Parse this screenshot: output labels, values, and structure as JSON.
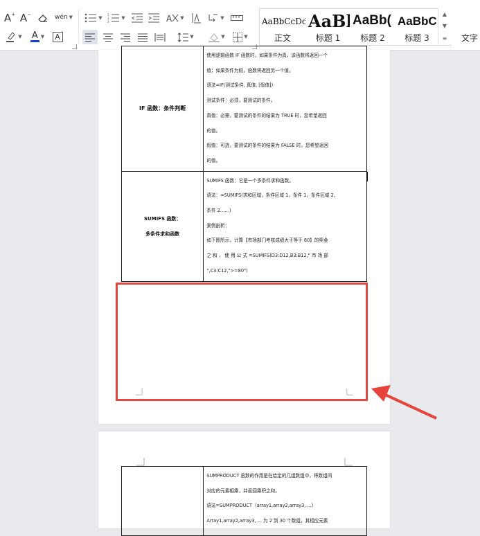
{
  "ribbon": {
    "font": {
      "grow_label": "A",
      "shrink_label": "A",
      "phonetic_label": "wén"
    },
    "styles": [
      {
        "sample": "AaBbCcDd",
        "label": "正文"
      },
      {
        "sample": "AaBl",
        "label": "标题 1"
      },
      {
        "sample": "AaBb(",
        "label": "标题 2"
      },
      {
        "sample": "AaBbC",
        "label": "标题 3"
      }
    ],
    "text_tool_label": "文字"
  },
  "page1": {
    "table": [
      {
        "label": "IF 函数：条件判断",
        "lines": [
          "使用逻辑函数 IF 函数时，如果条件为真，该函数将返回一个",
          "值；如果条件为假，函数将返回另一个值。",
          "语法=IF(测试条件, 真值, [假值])",
          "测试条件：必须，要测试的条件。",
          "真值：必需，要测试的条件的结果为 TRUE 时，您希望返回",
          "的值。",
          "假值：可选，要测试的条件的结果为 FALSE 时，您希望返回",
          "的值。"
        ]
      },
      {
        "label_line1": "SUMIFS 函数：",
        "label_line2": "多条件求和函数",
        "lines": [
          "SUMIFS 函数：它是一个多条件求和函数。",
          "语法：=SUMIFS(求和区域，条件区域 1，条件 1，条件区域 2,",
          "条件 2……)",
          "案例剖析：",
          "如下图所示，计算【市场部门考核成绩大于等于 80】的奖金",
          "之 和 ， 使 用 公 式 =SUMIFS(D3:D12,B3:B12,\" 市 场 部",
          "\",C3:C12,\">=80\")"
        ]
      }
    ]
  },
  "page2": {
    "table": [
      {
        "label": "",
        "lines": [
          "SUMPRODUCT 函数的作用是在给定的几组数组中，将数组间",
          "对应的元素相乘，并返回乘积之和。",
          "语法=SUMPRODUCT（array1,array2,array3, ...）",
          "Array1,array2,array3, ... 为 2 到 30 个数组，其相应元素"
        ]
      }
    ]
  },
  "annotation": {
    "highlight_color": "#e5453c"
  }
}
